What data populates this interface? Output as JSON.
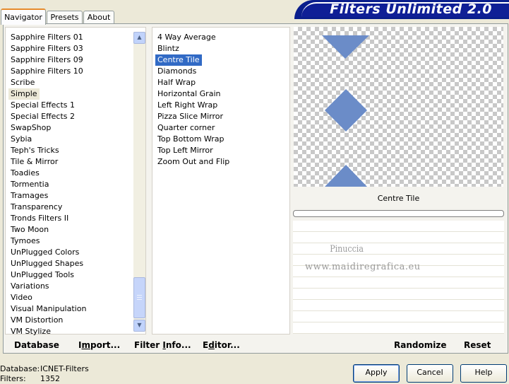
{
  "app_title": "Filters Unlimited 2.0",
  "tabs": [
    "Navigator",
    "Presets",
    "About"
  ],
  "categories": [
    "Sapphire Filters 01",
    "Sapphire Filters 03",
    "Sapphire Filters 09",
    "Sapphire Filters 10",
    "Scribe",
    "Simple",
    "Special Effects 1",
    "Special Effects 2",
    "SwapShop",
    "Sybia",
    "Teph's Tricks",
    "Tile & Mirror",
    "Toadies",
    "Tormentia",
    "Tramages",
    "Transparency",
    "Tronds Filters II",
    "Two Moon",
    "Tymoes",
    "UnPlugged Colors",
    "UnPlugged Shapes",
    "UnPlugged Tools",
    "Variations",
    "Video",
    "Visual Manipulation",
    "VM Distortion",
    "VM Stylize"
  ],
  "selected_category": "Simple",
  "filters": [
    "4 Way Average",
    "Blintz",
    "Centre Tile",
    "Diamonds",
    "Half Wrap",
    "Horizontal Grain",
    "Left Right Wrap",
    "Pizza Slice Mirror",
    "Quarter corner",
    "Top Bottom Wrap",
    "Top Left Mirror",
    "Zoom Out and Flip"
  ],
  "selected_filter": "Centre Tile",
  "preview_filter_name": "Centre Tile",
  "watermark": {
    "line1": "Pinuccia",
    "line2": "www.maidiregrafica.eu"
  },
  "bottom_buttons": {
    "database": "Database",
    "import_prefix": "I",
    "import_u": "m",
    "import_rest": "port...",
    "filterinfo_prefix": "Filter ",
    "filterinfo_u": "I",
    "filterinfo_rest": "nfo...",
    "editor_prefix": "E",
    "editor_u": "d",
    "editor_rest": "itor...",
    "randomize": "Randomize",
    "reset": "Reset"
  },
  "status": {
    "database_label": "Database:",
    "database_value": "ICNET-Filters",
    "filters_label": "Filters:",
    "filters_value": "1352"
  },
  "dialog_buttons": {
    "apply": "Apply",
    "cancel": "Cancel",
    "help": "Help"
  },
  "colors": {
    "selection": "#316ac5",
    "title_banner": "#0a1e8c",
    "diamond": "#6b8cc8"
  }
}
